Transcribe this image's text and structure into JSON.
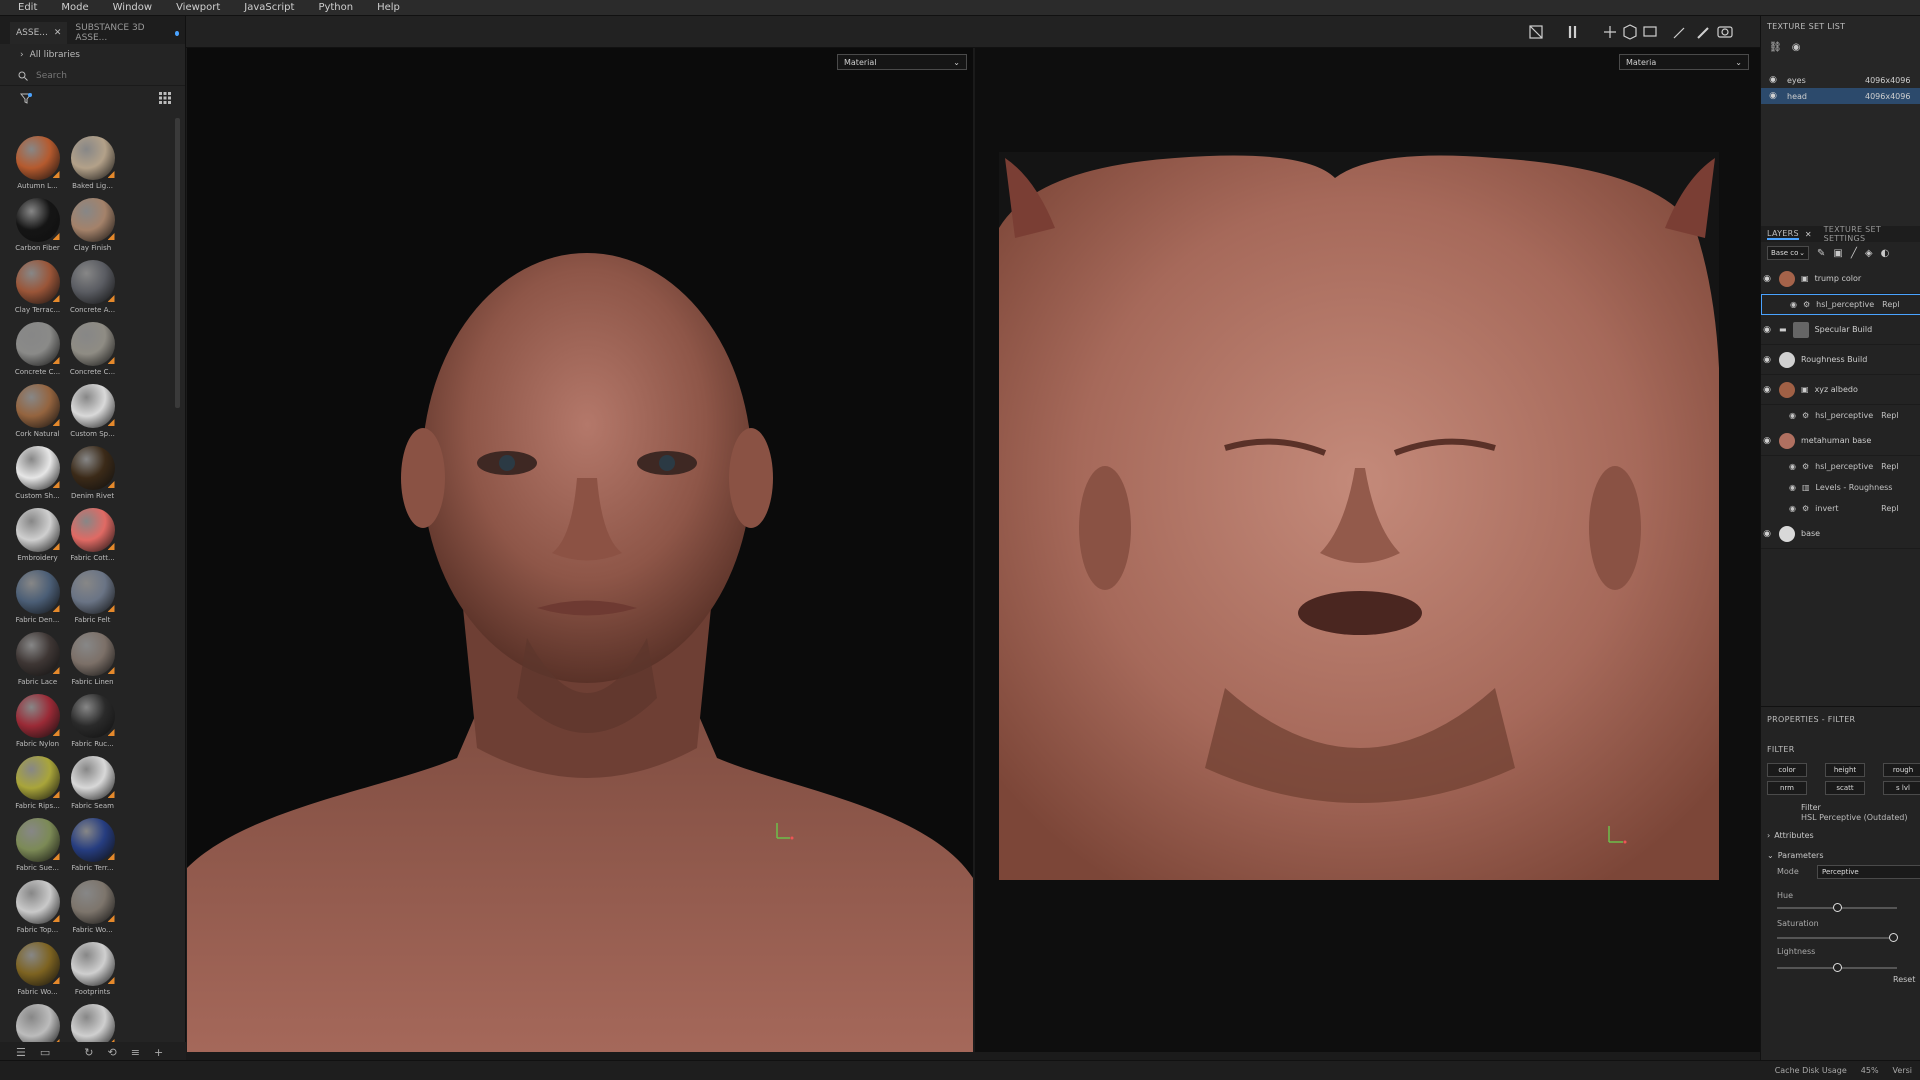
{
  "menu": [
    "Edit",
    "Mode",
    "Window",
    "Viewport",
    "JavaScript",
    "Python",
    "Help"
  ],
  "assets": {
    "tabs": [
      {
        "label": "ASSE...",
        "active": true
      },
      {
        "label": "SUBSTANCE 3D ASSE...",
        "active": false
      }
    ],
    "library": "All libraries",
    "search_placeholder": "Search",
    "materials": [
      {
        "label": "Autumn L...",
        "color": "#b55a2e"
      },
      {
        "label": "Baked Lig...",
        "color": "#b3a189"
      },
      {
        "label": "Carbon Fiber",
        "color": "#151515"
      },
      {
        "label": "Clay Finish",
        "color": "#a4826a"
      },
      {
        "label": "Clay Terrac...",
        "color": "#9a5538"
      },
      {
        "label": "Concrete A...",
        "color": "#5a5c62"
      },
      {
        "label": "Concrete C...",
        "color": "#8a8a88"
      },
      {
        "label": "Concrete C...",
        "color": "#8f8c84"
      },
      {
        "label": "Cork Natural",
        "color": "#94643f"
      },
      {
        "label": "Custom Sp...",
        "color": "#d9d9d9"
      },
      {
        "label": "Custom Sh...",
        "color": "#e6e6e6"
      },
      {
        "label": "Denim Rivet",
        "color": "#3b2a18"
      },
      {
        "label": "Embroidery",
        "color": "#cfcfcf"
      },
      {
        "label": "Fabric Cott...",
        "color": "#e06a64"
      },
      {
        "label": "Fabric Den...",
        "color": "#4b5e76"
      },
      {
        "label": "Fabric Felt",
        "color": "#6a7485"
      },
      {
        "label": "Fabric Lace",
        "color": "#3e3634"
      },
      {
        "label": "Fabric Linen",
        "color": "#7c7068"
      },
      {
        "label": "Fabric Nylon",
        "color": "#9a2a36"
      },
      {
        "label": "Fabric Ruc...",
        "color": "#2a2a2a"
      },
      {
        "label": "Fabric Rips...",
        "color": "#a9a53a"
      },
      {
        "label": "Fabric Seam",
        "color": "#d8d8d8"
      },
      {
        "label": "Fabric Sue...",
        "color": "#7c8a56"
      },
      {
        "label": "Fabric Terr...",
        "color": "#263d80"
      },
      {
        "label": "Fabric Top...",
        "color": "#c9c9c9"
      },
      {
        "label": "Fabric Wo...",
        "color": "#7d756c"
      },
      {
        "label": "Fabric Wo...",
        "color": "#7d6321"
      },
      {
        "label": "Footprints",
        "color": "#cfcfcf"
      },
      {
        "label": "",
        "color": "#bcbcbc"
      },
      {
        "label": "",
        "color": "#cfcfcf"
      }
    ]
  },
  "viewport3d": {
    "dropdown": "Material"
  },
  "viewport2d": {
    "dropdown": "Materia"
  },
  "texture_set_list": {
    "title": "TEXTURE SET LIST",
    "items": [
      {
        "name": "eyes",
        "res": "4096x4096",
        "selected": false
      },
      {
        "name": "head",
        "res": "4096x4096",
        "selected": true
      }
    ]
  },
  "layers_panel": {
    "tabs": [
      "LAYERS",
      "TEXTURE SET SETTINGS"
    ],
    "blend": "Base co",
    "layers": [
      {
        "name": "trump color",
        "thumb": "#a5634a"
      },
      {
        "name": "Specular Build",
        "thumb": "#666666"
      },
      {
        "name": "Roughness Build",
        "thumb": "#d0d0d0"
      },
      {
        "name": "xyz albedo",
        "thumb": "#a06045"
      },
      {
        "name": "metahuman base",
        "thumb": "#b07060"
      },
      {
        "name": "base",
        "thumb": "#d8d8d8"
      }
    ],
    "sublayers": {
      "trump_color": {
        "name": "hsl_perceptive",
        "mode": "Repl"
      },
      "xyz_albedo": {
        "name": "hsl_perceptive",
        "mode": "Repl"
      },
      "metahuman_1": {
        "name": "hsl_perceptive",
        "mode": "Repl"
      },
      "metahuman_2": {
        "name": "Levels - Roughness",
        "mode": ""
      },
      "metahuman_3": {
        "name": "invert",
        "mode": "Repl"
      }
    }
  },
  "properties": {
    "title": "PROPERTIES - FILTER",
    "filter_heading": "FILTER",
    "channels_row1": [
      "color",
      "height",
      "rough"
    ],
    "channels_row2": [
      "nrm",
      "scatt",
      "s lvl"
    ],
    "filter_label": "Filter",
    "filter_name": "HSL Perceptive (Outdated)",
    "attributes": "Attributes",
    "parameters": "Parameters",
    "mode_label": "Mode",
    "mode_value": "Perceptive",
    "sliders": [
      {
        "label": "Hue",
        "value": 0.5
      },
      {
        "label": "Saturation",
        "value": 1.0
      },
      {
        "label": "Lightness",
        "value": 0.5
      }
    ],
    "reset": "Reset"
  },
  "status": {
    "cache": "Cache Disk Usage",
    "percent": "45%",
    "version": "Versi"
  }
}
